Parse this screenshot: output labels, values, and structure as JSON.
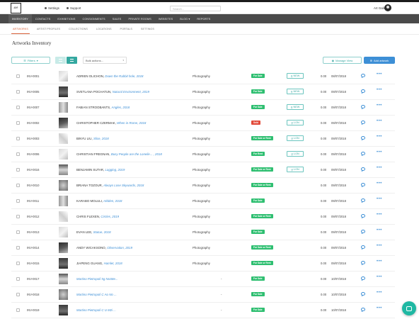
{
  "header": {
    "logo_text": "ae",
    "settings_label": "Settings",
    "support_label": "Support",
    "search_placeholder": "Search...",
    "user_name": "Art Gallery"
  },
  "main_nav": [
    "INVENTORY",
    "CONTACTS",
    "EXHIBITIONS",
    "CONSIGNMENTS",
    "SALES",
    "PRIVATE ROOMS",
    "WEBSITES",
    "BLOG",
    "REPORTS"
  ],
  "sub_nav": [
    "ARTWORKS",
    "ARTIST PROFILES",
    "COLLECTIONS",
    "LOCATIONS",
    "PORTALS",
    "SETTINGS"
  ],
  "page_title": "Artworks Inventory",
  "toolbar": {
    "filters_label": "Filters",
    "bulk_label": "Bulk actions...",
    "manage_label": "Manage View",
    "add_label": "Add artwork"
  },
  "colors": {
    "accent_teal": "#3ba9a3",
    "link_blue": "#3d8fd6",
    "for_sale": "#2fbf71",
    "sold": "#e24b3b",
    "nav_bg": "#4a4a4a",
    "active_tab": "#d9623b"
  },
  "rows": [
    {
      "id": "INV-0001",
      "artist": "ADRIEN OLICHON,",
      "work": "Down the Rabbit hole, 2018",
      "medium": "Photography",
      "dash": "",
      "status": "For Sale",
      "status_color": "#2fbf71",
      "loc": "NEW",
      "price": "0.00",
      "date": "08/07/2018",
      "thumb": "t-a"
    },
    {
      "id": "INV-0005",
      "artist": "SVETLANA POCHATUN,",
      "work": "Natural Environment, 2019",
      "medium": "Photography",
      "dash": "",
      "status": "For Sale",
      "status_color": "#2fbf71",
      "loc": "NEW",
      "price": "0.00",
      "date": "09/07/2018",
      "thumb": "t-b"
    },
    {
      "id": "INV-0007",
      "artist": "FABIAN STROOBANTS,",
      "work": "Angles, 2018",
      "medium": "Photography",
      "dash": "",
      "status": "For Sale",
      "status_color": "#2fbf71",
      "loc": "NEW",
      "price": "0.00",
      "date": "09/07/2018",
      "thumb": "t-c"
    },
    {
      "id": "INV-0002",
      "artist": "CHRISTOPHER CZERMAK,",
      "work": "When in Rome, 2018",
      "medium": "Photography",
      "dash": "",
      "status": "Sold",
      "status_color": "#e24b3b",
      "loc": "LON",
      "price": "0.00",
      "date": "09/07/2018",
      "thumb": "t-d"
    },
    {
      "id": "INV-0003",
      "artist": "BINYU LIU,",
      "work": "Slice, 2018",
      "medium": "Photography",
      "dash": "",
      "status": "For Sale or Rent",
      "status_color": "#2fbf71",
      "loc": "LON",
      "price": "0.00",
      "date": "09/07/2018",
      "thumb": "t-e"
    },
    {
      "id": "INV-0006",
      "artist": "CHRISTIAN FREGNAN,",
      "work": "Busy People are the Loneliе... , 2018",
      "medium": "Photography",
      "dash": "",
      "status": "For Rent",
      "status_color": "#2fbf71",
      "loc": "LON",
      "price": "0.00",
      "date": "09/07/2018",
      "thumb": "t-a"
    },
    {
      "id": "INV-0016",
      "artist": "BENJAMIN SUTAR,",
      "work": "Lagging, 2019",
      "medium": "Photography",
      "dash": "",
      "status": "For Sale or Rent",
      "status_color": "#2fbf71",
      "loc": "LON",
      "price": "0.00",
      "date": "09/07/2018",
      "thumb": "t-f"
    },
    {
      "id": "INV-0010",
      "artist": "BRIANA TOZOUR,",
      "work": "Always Lose Skywards, 2018",
      "medium": "Photography",
      "dash": "",
      "status": "For Sale or Rent",
      "status_color": "#2fbf71",
      "loc": "",
      "price": "0.00",
      "date": "09/07/2018",
      "thumb": "t-g"
    },
    {
      "id": "INV-0011",
      "artist": "KARABO MOLULI,",
      "work": "Hidden, 2018",
      "medium": "Photography",
      "dash": "",
      "status": "For Sale",
      "status_color": "#2fbf71",
      "loc": "",
      "price": "0.00",
      "date": "09/07/2018",
      "thumb": "t-c"
    },
    {
      "id": "INV-0012",
      "artist": "CHRIS FLEXEN,",
      "work": "Circles, 2019",
      "medium": "Photography",
      "dash": "",
      "status": "For Sale or Rent",
      "status_color": "#2fbf71",
      "loc": "",
      "price": "0.00",
      "date": "09/07/2018",
      "thumb": "t-e"
    },
    {
      "id": "INV-0013",
      "artist": "EVAN LEE,",
      "work": "Statue, 2018",
      "medium": "Photography",
      "dash": "",
      "status": "For Sale",
      "status_color": "#2fbf71",
      "loc": "",
      "price": "0.00",
      "date": "09/07/2018",
      "thumb": "t-a"
    },
    {
      "id": "INV-0014",
      "artist": "ANDY WICAKSONO,",
      "work": "Observation, 2019",
      "medium": "Photography",
      "dash": "",
      "status": "For Sale or Rent",
      "status_color": "#2fbf71",
      "loc": "",
      "price": "0.00",
      "date": "09/07/2018",
      "thumb": "t-d"
    },
    {
      "id": "INV-0015",
      "artist": "JIAPENG GUANG,",
      "work": "Hamlet, 2018",
      "medium": "Photography",
      "dash": "",
      "status": "For Sale or Rent",
      "status_color": "#2fbf71",
      "loc": "",
      "price": "0.00",
      "date": "09/07/2018",
      "thumb": "t-b"
    },
    {
      "id": "INV-0017",
      "artist": "",
      "work": "Martino Pietropoli 5g NoS8e...",
      "medium": "",
      "dash": "-",
      "status": "For Sale",
      "status_color": "#2fbf71",
      "loc": "",
      "price": "0.00",
      "date": "10/07/2018",
      "thumb": "t-f"
    },
    {
      "id": "INV-0018",
      "artist": "",
      "work": "Martino Pietropoli C Ao No ...",
      "medium": "",
      "dash": "-",
      "status": "For Sale",
      "status_color": "#2fbf71",
      "loc": "",
      "price": "0.00",
      "date": "10/07/2018",
      "thumb": "t-g"
    },
    {
      "id": "INV-0019",
      "artist": "",
      "work": "Martino Pietropoli C U Mzi ...",
      "medium": "",
      "dash": "-",
      "status": "For Sale",
      "status_color": "#2fbf71",
      "loc": "",
      "price": "0.00",
      "date": "10/07/2018",
      "thumb": "t-b"
    }
  ]
}
